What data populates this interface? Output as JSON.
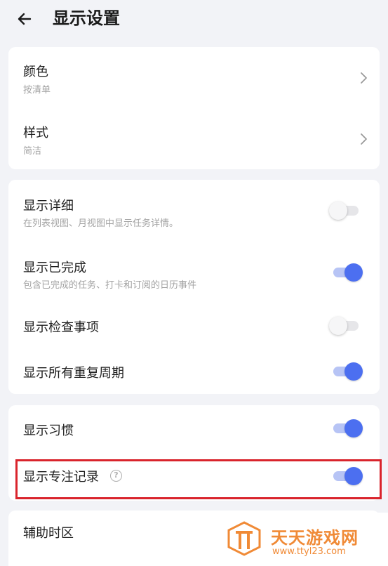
{
  "header": {
    "title": "显示设置"
  },
  "group1": [
    {
      "title": "颜色",
      "subtitle": "按清单"
    },
    {
      "title": "样式",
      "subtitle": "简洁"
    }
  ],
  "group2": [
    {
      "title": "显示详细",
      "subtitle": "在列表视图、月视图中显示任务详情。",
      "enabled": false
    },
    {
      "title": "显示已完成",
      "subtitle": "包含已完成的任务、打卡和订阅的日历事件",
      "enabled": true
    },
    {
      "title": "显示检查事项",
      "enabled": false
    },
    {
      "title": "显示所有重复周期",
      "enabled": true
    }
  ],
  "group3": [
    {
      "title": "显示习惯",
      "enabled": true
    },
    {
      "title": "显示专注记录",
      "help": "?",
      "enabled": true
    }
  ],
  "group4": [
    {
      "title": "辅助时区"
    }
  ],
  "watermark": {
    "brand": "天天游戏网",
    "url": "www.ttyl23.com"
  },
  "colors": {
    "accent": "#4c6ff0",
    "highlight": "#d9242c",
    "watermark": "#f08a36"
  }
}
